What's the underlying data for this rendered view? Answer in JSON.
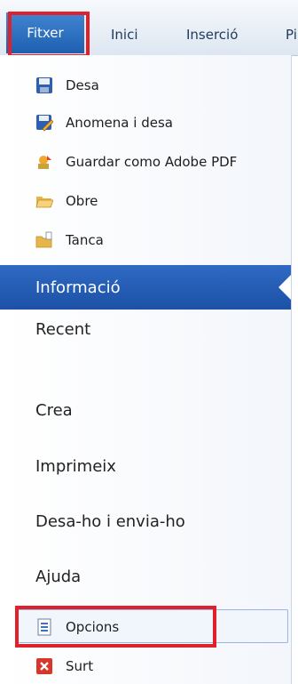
{
  "tabs": {
    "file": "Fitxer",
    "home": "Inici",
    "insert": "Inserció",
    "next": "Pi"
  },
  "commands": [
    {
      "label": "Desa",
      "icon": "save-icon"
    },
    {
      "label": "Anomena i desa",
      "icon": "save-as-icon"
    },
    {
      "label": "Guardar como Adobe PDF",
      "icon": "adobe-pdf-icon"
    },
    {
      "label": "Obre",
      "icon": "open-folder-icon"
    },
    {
      "label": "Tanca",
      "icon": "close-folder-icon"
    }
  ],
  "sections": {
    "info": "Informació",
    "recent": "Recent",
    "new": "Crea",
    "print": "Imprimeix",
    "share": "Desa-ho i envia-ho",
    "help": "Ajuda"
  },
  "bottom_commands": {
    "options": "Opcions",
    "exit": "Surt"
  },
  "colors": {
    "accent": "#1f5fb0",
    "highlight_box": "#e0202b"
  }
}
